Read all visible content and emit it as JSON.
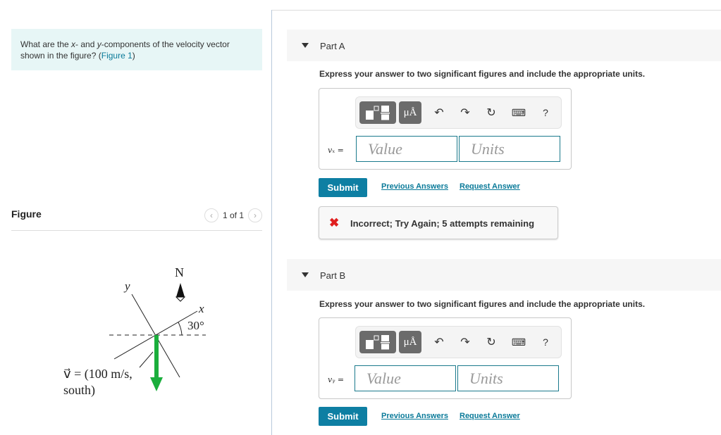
{
  "question": {
    "text_before": "What are the ",
    "x_var": "x",
    "text_mid": "- and ",
    "y_var": "y",
    "text_after": "-components of the velocity vector shown in the figure? (",
    "figure_link": "Figure 1",
    "close_paren": ")"
  },
  "figure": {
    "title": "Figure",
    "pager": "1 of 1",
    "prev_icon": "chevron-left-icon",
    "next_icon": "chevron-right-icon",
    "labels": {
      "north": "N",
      "y_axis": "y",
      "x_axis": "x",
      "angle": "30°",
      "vector_line1": "v⃗ = (100 m/s,",
      "vector_line2": "south)"
    },
    "vector_color": "#1aae3c"
  },
  "parts": [
    {
      "label": "Part A",
      "instructions": "Express your answer to two significant figures and include the appropriate units.",
      "variable": "vₓ =",
      "value_placeholder": "Value",
      "units_placeholder": "Units",
      "toolbar": {
        "templates": "templates-icon",
        "units": "μÅ",
        "undo": "undo-icon",
        "redo": "redo-icon",
        "reset": "reset-icon",
        "keyboard": "keyboard-icon",
        "help": "?"
      },
      "submit": "Submit",
      "previous_answers": "Previous Answers",
      "request_answer": "Request Answer",
      "feedback": "Incorrect; Try Again; 5 attempts remaining"
    },
    {
      "label": "Part B",
      "instructions": "Express your answer to two significant figures and include the appropriate units.",
      "variable": "vᵧ =",
      "value_placeholder": "Value",
      "units_placeholder": "Units",
      "toolbar": {
        "templates": "templates-icon",
        "units": "μÅ",
        "undo": "undo-icon",
        "redo": "redo-icon",
        "reset": "reset-icon",
        "keyboard": "keyboard-icon",
        "help": "?"
      },
      "submit": "Submit",
      "previous_answers": "Previous Answers",
      "request_answer": "Request Answer"
    }
  ],
  "colors": {
    "accent": "#0e7fa3",
    "link": "#0a7a99",
    "error": "#e01f1f",
    "question_bg": "#e7f6f6"
  }
}
